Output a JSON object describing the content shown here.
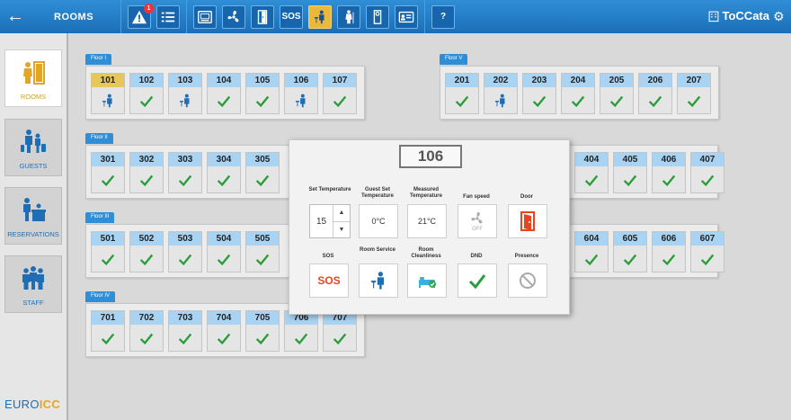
{
  "header": {
    "back_icon": "arrow-left-icon",
    "title": "ROOMS",
    "alarm_badge": "1",
    "sos_label": "SOS",
    "help_label": "?",
    "brand_prefix": "ToCC",
    "brand_suffix": "ata",
    "colors": {
      "bar": "#1f79c4",
      "active": "#e9b93b"
    }
  },
  "sidebar": {
    "items": [
      {
        "label": "ROOMS",
        "icon": "door-person-icon",
        "active": true
      },
      {
        "label": "GUESTS",
        "icon": "guests-icon",
        "active": false
      },
      {
        "label": "RESERVATIONS",
        "icon": "reservations-icon",
        "active": false
      },
      {
        "label": "STAFF",
        "icon": "staff-icon",
        "active": false
      }
    ],
    "logo_a": "EURO",
    "logo_b": "ICC"
  },
  "floors": [
    {
      "name": "Floor I",
      "rooms": [
        {
          "num": "101",
          "status": "service",
          "highlight": true
        },
        {
          "num": "102",
          "status": "ok"
        },
        {
          "num": "103",
          "status": "service"
        },
        {
          "num": "104",
          "status": "ok"
        },
        {
          "num": "105",
          "status": "ok"
        },
        {
          "num": "106",
          "status": "service"
        },
        {
          "num": "107",
          "status": "ok"
        }
      ]
    },
    {
      "name": "Floor II",
      "rooms": [
        {
          "num": "301",
          "status": "ok"
        },
        {
          "num": "302",
          "status": "ok"
        },
        {
          "num": "303",
          "status": "ok"
        },
        {
          "num": "304",
          "status": "ok"
        },
        {
          "num": "305",
          "status": "ok"
        }
      ]
    },
    {
      "name": "Floor III",
      "rooms": [
        {
          "num": "501",
          "status": "ok"
        },
        {
          "num": "502",
          "status": "ok"
        },
        {
          "num": "503",
          "status": "ok"
        },
        {
          "num": "504",
          "status": "ok"
        },
        {
          "num": "505",
          "status": "ok"
        }
      ]
    },
    {
      "name": "Floor IV",
      "rooms": [
        {
          "num": "701",
          "status": "ok"
        },
        {
          "num": "702",
          "status": "ok"
        },
        {
          "num": "703",
          "status": "ok"
        },
        {
          "num": "704",
          "status": "ok"
        },
        {
          "num": "705",
          "status": "ok"
        },
        {
          "num": "706",
          "status": "ok"
        },
        {
          "num": "707",
          "status": "ok"
        }
      ]
    },
    {
      "name": "Floor V",
      "rooms": [
        {
          "num": "201",
          "status": "ok"
        },
        {
          "num": "202",
          "status": "service"
        },
        {
          "num": "203",
          "status": "ok"
        },
        {
          "num": "204",
          "status": "ok"
        },
        {
          "num": "205",
          "status": "ok"
        },
        {
          "num": "206",
          "status": "ok"
        },
        {
          "num": "207",
          "status": "ok"
        }
      ]
    },
    {
      "name": "",
      "rooms": [
        {
          "num": "404",
          "status": "ok"
        },
        {
          "num": "405",
          "status": "ok"
        },
        {
          "num": "406",
          "status": "ok"
        },
        {
          "num": "407",
          "status": "ok"
        }
      ]
    },
    {
      "name": "",
      "rooms": [
        {
          "num": "604",
          "status": "ok"
        },
        {
          "num": "605",
          "status": "ok"
        },
        {
          "num": "606",
          "status": "ok"
        },
        {
          "num": "607",
          "status": "ok"
        }
      ]
    }
  ],
  "popup": {
    "room": "106",
    "set_temp_label": "Set Temperature",
    "set_temp_value": "15",
    "guest_temp_label": "Guest Set Temperature",
    "guest_temp_value": "0°C",
    "measured_label": "Measured Temperature",
    "measured_value": "21°C",
    "fan_label": "Fan speed",
    "fan_value": "OFF",
    "door_label": "Door",
    "sos_label": "SOS",
    "sos_value": "SOS",
    "service_label": "Room Service",
    "clean_label": "Room Cleanliness",
    "dnd_label": "DND",
    "presence_label": "Presence"
  }
}
